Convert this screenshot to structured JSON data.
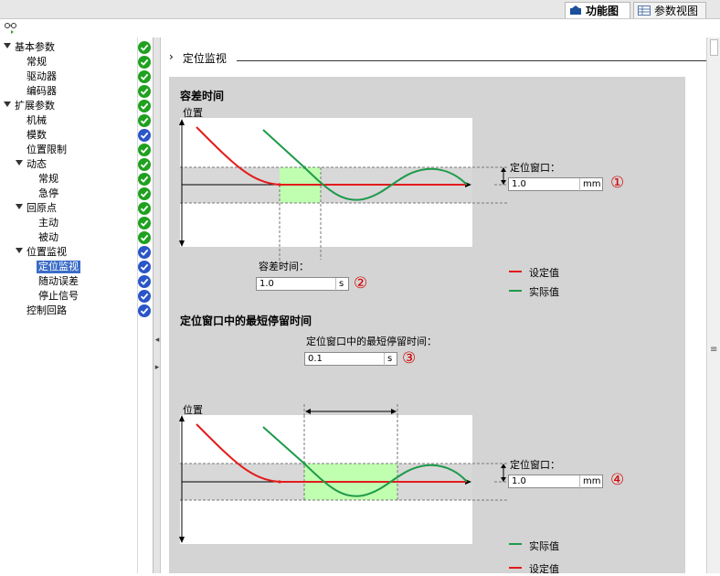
{
  "tabs": [
    {
      "label": "功能图",
      "active": true,
      "icon": "function-view-icon"
    },
    {
      "label": "参数视图",
      "active": false,
      "icon": "parameter-view-icon"
    }
  ],
  "tree": [
    {
      "label": "基本参数",
      "level": 0,
      "expanded": true,
      "status": "green"
    },
    {
      "label": "常规",
      "level": 1,
      "status": "green"
    },
    {
      "label": "驱动器",
      "level": 1,
      "status": "green"
    },
    {
      "label": "编码器",
      "level": 1,
      "status": "green"
    },
    {
      "label": "扩展参数",
      "level": 0,
      "expanded": true,
      "status": "green"
    },
    {
      "label": "机械",
      "level": 1,
      "status": "green"
    },
    {
      "label": "模数",
      "level": 1,
      "status": "blue"
    },
    {
      "label": "位置限制",
      "level": 1,
      "status": "green"
    },
    {
      "label": "动态",
      "level": 1,
      "expanded": true,
      "status": "green"
    },
    {
      "label": "常规",
      "level": 2,
      "status": "green"
    },
    {
      "label": "急停",
      "level": 2,
      "status": "green"
    },
    {
      "label": "回原点",
      "level": 1,
      "expanded": true,
      "status": "green"
    },
    {
      "label": "主动",
      "level": 2,
      "status": "green"
    },
    {
      "label": "被动",
      "level": 2,
      "status": "green"
    },
    {
      "label": "位置监视",
      "level": 1,
      "expanded": true,
      "status": "blue"
    },
    {
      "label": "定位监视",
      "level": 2,
      "status": "blue",
      "selected": true
    },
    {
      "label": "随动误差",
      "level": 2,
      "status": "blue"
    },
    {
      "label": "停止信号",
      "level": 2,
      "status": "blue"
    },
    {
      "label": "控制回路",
      "level": 1,
      "status": "blue"
    }
  ],
  "section": {
    "arrow": "›",
    "title": "定位监视"
  },
  "diagram1": {
    "title": "容差时间",
    "y_label": "位置",
    "window_label": "定位窗口：",
    "window_value": "1.0",
    "window_unit": "mm",
    "window_marker": "①",
    "time_label": "容差时间：",
    "time_value": "1.0",
    "time_unit": "s",
    "time_marker": "②",
    "legend": [
      {
        "label": "设定值",
        "color": "#e31b1b"
      },
      {
        "label": "实际值",
        "color": "#1e9a4a"
      }
    ]
  },
  "diagram2": {
    "title": "定位窗口中的最短停留时间",
    "y_label": "位置",
    "dwell_label": "定位窗口中的最短停留时间：",
    "dwell_value": "0.1",
    "dwell_unit": "s",
    "dwell_marker": "③",
    "window_label": "定位窗口：",
    "window_value": "1.0",
    "window_unit": "mm",
    "window_marker": "④",
    "legend": [
      {
        "label": "设定值",
        "color": "#e31b1b"
      },
      {
        "label": "实际值",
        "color": "#1e9a4a"
      }
    ]
  },
  "colors": {
    "setpoint": "#e31b1b",
    "actual": "#1e9a4a",
    "window_band": "#c0ffb0",
    "selected": "#3b6cc8",
    "status_ok": "#1fa11f",
    "status_info": "#2a55c8"
  }
}
